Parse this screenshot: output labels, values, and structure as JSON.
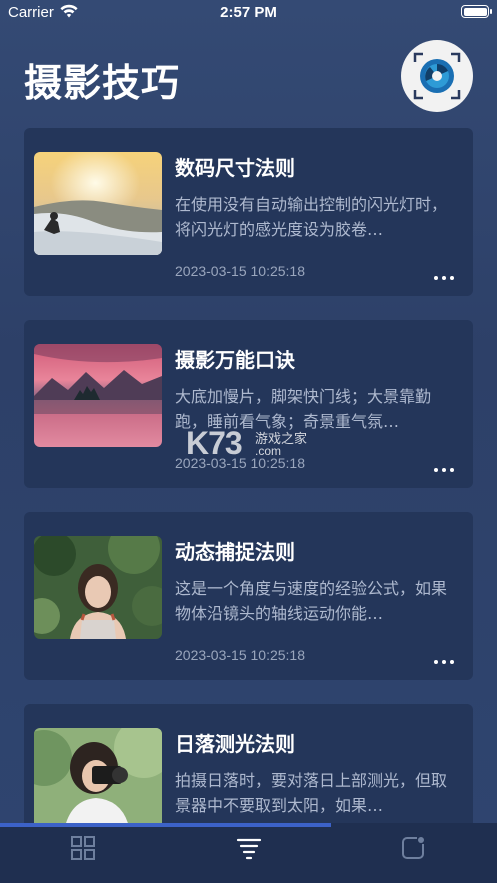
{
  "status_bar": {
    "carrier": "Carrier",
    "time": "2:57 PM"
  },
  "header": {
    "title": "摄影技巧",
    "logo_icon": "camera-aperture-icon"
  },
  "articles": [
    {
      "title": "数码尺寸法则",
      "excerpt": "在使用没有自动输出控制的闪光灯时，将闪光灯的感光度设为胶卷…",
      "date": "2023-03-15 10:25:18",
      "thumbnail": "photographer-on-snowy-hill"
    },
    {
      "title": "摄影万能口诀",
      "excerpt": "大底加慢片，脚架快门线；大景靠勤跑，睡前看气象；奇景重气氛…",
      "date": "2023-03-15 10:25:18",
      "thumbnail": "lake-island-sunset"
    },
    {
      "title": "动态捕捉法则",
      "excerpt": "这是一个角度与速度的经验公式，如果物体沿镜头的轴线运动你能…",
      "date": "2023-03-15 10:25:18",
      "thumbnail": "woman-under-leaves"
    },
    {
      "title": "日落测光法则",
      "excerpt": "拍摄日落时，要对落日上部测光，但取景器中不要取到太阳，如果…",
      "date": "",
      "thumbnail": "woman-with-camera"
    }
  ],
  "watermark": {
    "logo": "K73",
    "site_name": "游戏之家",
    "domain": ".com"
  },
  "tab_bar": {
    "tabs": [
      {
        "icon": "grid-icon",
        "active": false
      },
      {
        "icon": "filter-list-icon",
        "active": true
      },
      {
        "icon": "note-icon",
        "active": false
      }
    ],
    "progress": 0.666
  },
  "colors": {
    "background": "#2f4570",
    "card": "#24365a",
    "tab_bar": "#1f2f50",
    "accent": "#3c62c8"
  }
}
